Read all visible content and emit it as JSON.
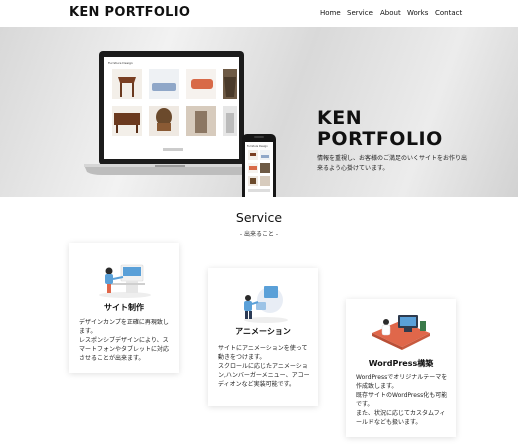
{
  "header": {
    "logo": "KEN PORTFOLIO",
    "nav": [
      "Home",
      "Service",
      "About",
      "Works",
      "Contact"
    ]
  },
  "hero": {
    "title_line1": "KEN",
    "title_line2": "PORTFOLIO",
    "description": "情報を重視し、お客様のご満足のいくサイトをお作り出来るよう心掛けています。"
  },
  "service": {
    "title": "Service",
    "subtitle": "- 出来ること -",
    "cards": [
      {
        "title": "サイト制作",
        "text": "デザインカンプを正確に再現致します。\nレスポンシブデザインにより、スマートフォンやタブレットに対応させることが出来ます。",
        "icon": "web-design-icon"
      },
      {
        "title": "アニメーション",
        "text": "サイトにアニメーションを使って動きをつけます。\nスクロールに応じたアニメーション,ハンバーガーメニュー、アコーディオンなど実装可能です。",
        "icon": "animation-icon"
      },
      {
        "title": "WordPress構築",
        "text": "WordPressでオリジナルテーマを作成致します。\n既存サイトのWordPress化も可能です。\nまた、状況に応じてカスタムフィールドなども扱います。",
        "icon": "wordpress-icon"
      }
    ]
  },
  "colors": {
    "accent_orange": "#e0674a",
    "accent_blue": "#5aa0d8",
    "text": "#111111"
  }
}
